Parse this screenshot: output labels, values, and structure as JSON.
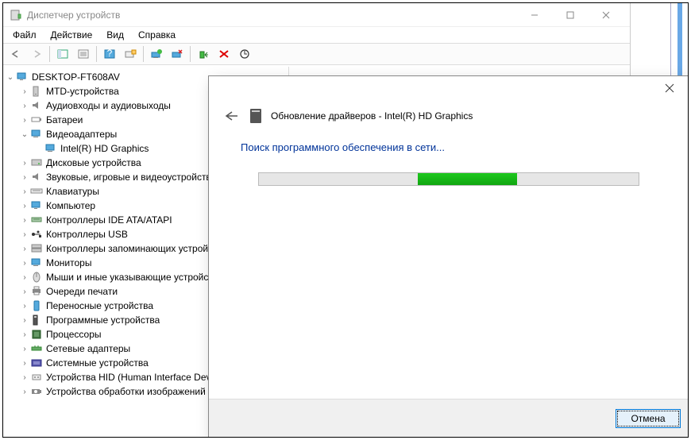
{
  "window": {
    "title": "Диспетчер устройств"
  },
  "menu": {
    "file": "Файл",
    "action": "Действие",
    "view": "Вид",
    "help": "Справка"
  },
  "tree": {
    "root": "DESKTOP-FT608AV",
    "items": [
      "MTD-устройства",
      "Аудиовходы и аудиовыходы",
      "Батареи",
      "Видеоадаптеры",
      "Дисковые устройства",
      "Звуковые, игровые и видеоустройства",
      "Клавиатуры",
      "Компьютер",
      "Контроллеры IDE ATA/ATAPI",
      "Контроллеры USB",
      "Контроллеры запоминающих устройств",
      "Мониторы",
      "Мыши и иные указывающие устройства",
      "Очереди печати",
      "Переносные устройства",
      "Программные устройства",
      "Процессоры",
      "Сетевые адаптеры",
      "Системные устройства",
      "Устройства HID (Human Interface Devices)",
      "Устройства обработки изображений"
    ],
    "video_child": "Intel(R) HD Graphics"
  },
  "dialog": {
    "title": "Обновление драйверов - Intel(R) HD Graphics",
    "status": "Поиск программного обеспечения в сети...",
    "cancel": "Отмена"
  }
}
